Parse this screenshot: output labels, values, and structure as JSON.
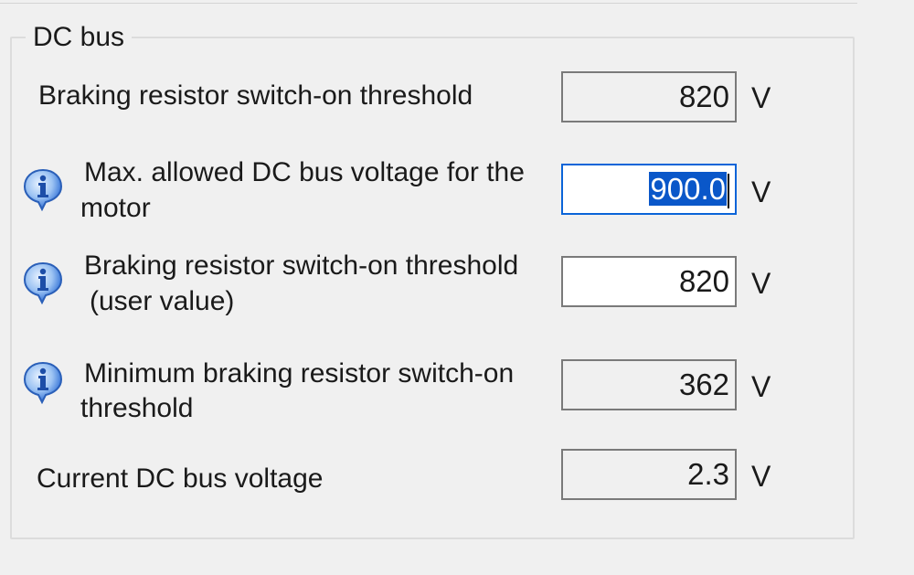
{
  "group": {
    "title": "DC bus"
  },
  "rows": [
    {
      "label_line1": "Braking resistor switch-on threshold",
      "value": "820",
      "unit": "V"
    },
    {
      "label_line1": "Max. allowed DC bus voltage for the",
      "label_line2": "motor",
      "value": "900.0",
      "unit": "V",
      "icon": "info-icon"
    },
    {
      "label_line1": "Braking resistor switch-on threshold",
      "label_line2": "(user value)",
      "value": "820",
      "unit": "V",
      "icon": "info-icon"
    },
    {
      "label_line1": "Minimum braking resistor switch-on",
      "label_line2": "threshold",
      "value": "362",
      "unit": "V",
      "icon": "info-icon"
    },
    {
      "label_line1": "Current DC bus voltage",
      "value": "2.3",
      "unit": "V"
    }
  ],
  "colors": {
    "selection": "#0a57c9",
    "focus_border": "#0a64d8",
    "icon_blue": "#2f6fd6"
  }
}
